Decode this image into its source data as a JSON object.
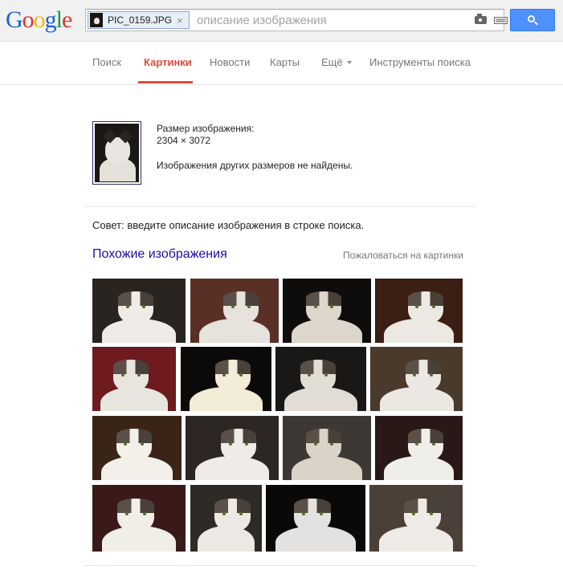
{
  "header": {
    "logo_letters": [
      {
        "ch": "G",
        "color": "#1a62d6"
      },
      {
        "ch": "o",
        "color": "#d8372c"
      },
      {
        "ch": "o",
        "color": "#f1b90d"
      },
      {
        "ch": "g",
        "color": "#1a62d6"
      },
      {
        "ch": "l",
        "color": "#1e9e3a"
      },
      {
        "ch": "e",
        "color": "#d8372c"
      }
    ],
    "image_chip": {
      "filename": "PIC_0159.JPG",
      "remove": "×"
    },
    "query_placeholder": "описание изображения",
    "icons": [
      "camera-icon",
      "keyboard-icon",
      "search-icon"
    ]
  },
  "nav": {
    "items": [
      {
        "label": "Поиск",
        "active": false
      },
      {
        "label": "Картинки",
        "active": true
      },
      {
        "label": "Новости",
        "active": false
      },
      {
        "label": "Карты",
        "active": false
      },
      {
        "label": "Ещё",
        "active": false,
        "dropdown": true
      },
      {
        "label": "Инструменты поиска",
        "active": false
      }
    ],
    "accent_color": "#dd4b39"
  },
  "image_info": {
    "size_label": "Размер изображения:",
    "size_value": "2304 × 3072",
    "no_other_sizes": "Изображения других размеров не найдены."
  },
  "tip": "Совет: введите описание изображения в строке поиска.",
  "similar": {
    "title": "Похожие изображения",
    "report": "Пожаловаться на картинки",
    "link_color": "#1a0dab"
  },
  "similar_images": [
    {
      "bg": "#2a2420",
      "fur": "#efece8"
    },
    {
      "bg": "#5a3026",
      "fur": "#e6e2dc"
    },
    {
      "bg": "#0f0d0c",
      "fur": "#dcd6cc"
    },
    {
      "bg": "#3b1e14",
      "fur": "#ece8e2"
    },
    {
      "bg": "#6e1a1e",
      "fur": "#e8e4de"
    },
    {
      "bg": "#0c0a08",
      "fur": "#f2ecd8"
    },
    {
      "bg": "#1a1816",
      "fur": "#e2ddd4"
    },
    {
      "bg": "#4a3a2c",
      "fur": "#ebe8e4"
    },
    {
      "bg": "#3a2418",
      "fur": "#f3f0ea"
    },
    {
      "bg": "#2c2724",
      "fur": "#efebe6"
    },
    {
      "bg": "#3c3834",
      "fur": "#d9d3c8"
    },
    {
      "bg": "#2a1816",
      "fur": "#f0eeea"
    },
    {
      "bg": "#3a1a18",
      "fur": "#f1eee8"
    },
    {
      "bg": "#2e2a26",
      "fur": "#ece9e4"
    },
    {
      "bg": "#0a0908",
      "fur": "#e4e2e0"
    },
    {
      "bg": "#4a4038",
      "fur": "#eeebe6"
    }
  ]
}
